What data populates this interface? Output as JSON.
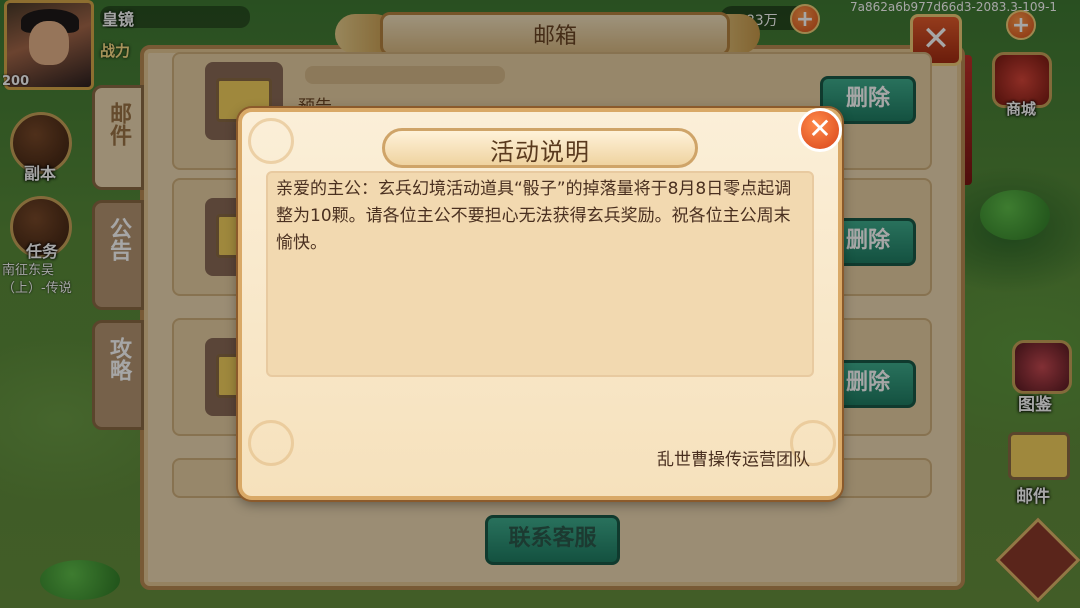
{
  "watermark": "7a862a6b977d66d3-2083.3-109-1",
  "player": {
    "name": "皇镜",
    "power": "战力",
    "level": "200"
  },
  "resources": {
    "value": "2083万",
    "plus_icon": "plus-icon"
  },
  "left_menu": {
    "dungeon": "副本",
    "quest": "任务",
    "quest_detail": "南征东吴（上）-传说"
  },
  "right_menu": {
    "shop": "商城",
    "atlas": "图鉴",
    "mail": "邮件"
  },
  "mailbox": {
    "title": "邮箱",
    "tabs": [
      "邮件",
      "公告",
      "攻略"
    ],
    "rows": [
      {
        "subtitle": "预告",
        "delete_label": "删除"
      },
      {
        "delete_label": "删除"
      },
      {
        "delete_label": "删除"
      }
    ],
    "contact_label": "联系客服"
  },
  "dialog": {
    "title": "活动说明",
    "body": "亲爱的主公：玄兵幻境活动道具“骰子”的掉落量将于8月8日零点起调整为10颗。请各位主公不要担心无法获得玄兵奖励。祝各位主公周末愉快。",
    "signature": "乱世曹操传运营团队"
  },
  "colors": {
    "accent": "#d8441a",
    "button_green": "#2f9a7a",
    "panel": "#f6e1bc"
  }
}
